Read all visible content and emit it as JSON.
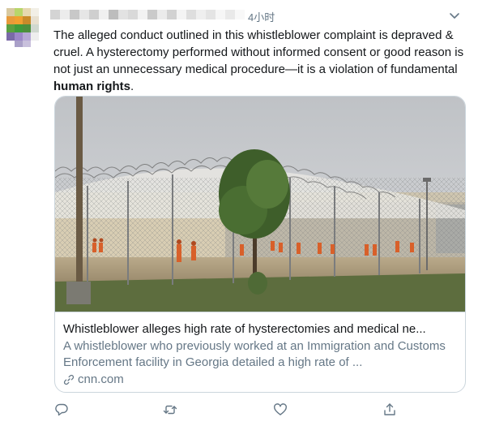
{
  "tweet": {
    "timestamp": "4小时",
    "text_parts": {
      "main": "The alleged conduct outlined in this whistleblower complaint is depraved & cruel. A hysterectomy performed without informed consent or good reason is not just an unnecessary medical procedure—it is a violation of fundamental ",
      "bold": "human rights",
      "end": "."
    },
    "card": {
      "title": "Whistleblower alleges high rate of hysterectomies and medical ne...",
      "description": "A whistleblower who previously worked at an Immigration and Customs Enforcement facility in Georgia detailed a high rate of ...",
      "domain": "cnn.com",
      "image_caption": "Detention facility yard behind razor-wire fence"
    },
    "icons": {
      "menu": "chevron-down-icon",
      "reply": "reply-icon",
      "retweet": "retweet-icon",
      "like": "heart-icon",
      "share": "share-icon",
      "link": "link-icon"
    },
    "colors": {
      "text": "#14171a",
      "secondary": "#657786",
      "border": "#ccd6dd"
    }
  }
}
